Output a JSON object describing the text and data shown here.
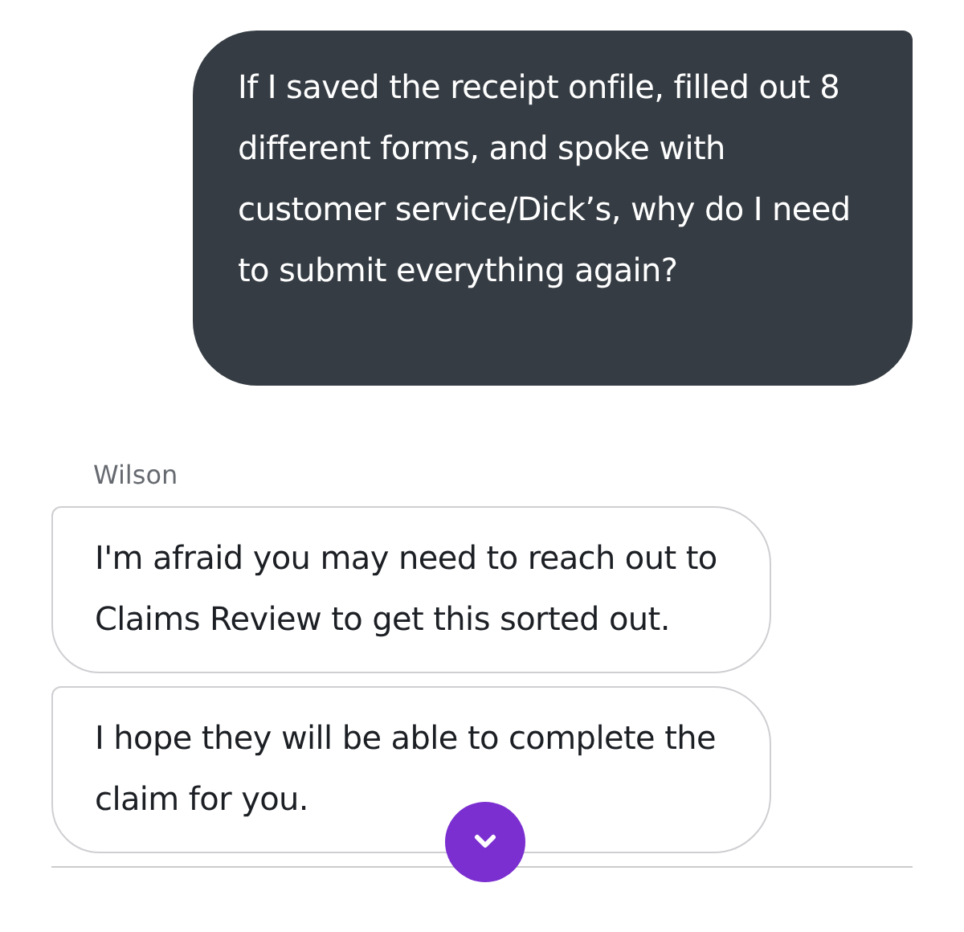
{
  "messages": [
    {
      "kind": "outgoing",
      "text": "If I saved the receipt onfile, filled out 8 different forms, and spoke with customer service/Dick’s, why do I need to submit everything again?"
    },
    {
      "kind": "sender",
      "text": "Wilson"
    },
    {
      "kind": "incoming",
      "text": "I'm afraid you may need to reach out to Claims Review to get this sorted out."
    },
    {
      "kind": "incoming",
      "text": "I hope they will be able to complete the claim for you."
    }
  ]
}
